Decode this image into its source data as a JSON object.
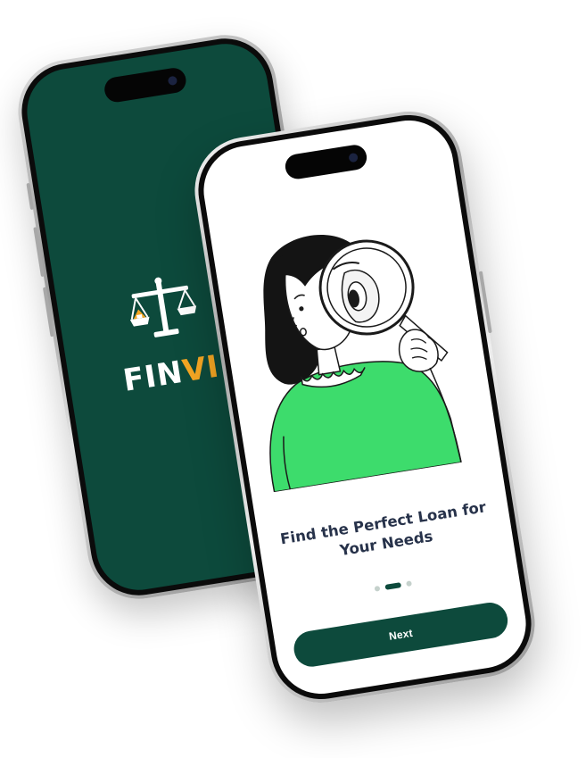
{
  "splash_screen": {
    "logo_text_main": "FIN",
    "logo_text_accent": "VI",
    "icon": "scales-of-justice-icon",
    "background_color": "#0d4a3c",
    "accent_color": "#f5a623"
  },
  "onboarding_screen": {
    "illustration": "woman-with-magnifying-glass-illustration",
    "title": "Find the Perfect Loan for Your Needs",
    "pagination": {
      "total": 3,
      "active_index": 1
    },
    "next_button_label": "Next",
    "primary_color": "#0d4a3c",
    "illustration_accent_color": "#3ddc6c"
  }
}
